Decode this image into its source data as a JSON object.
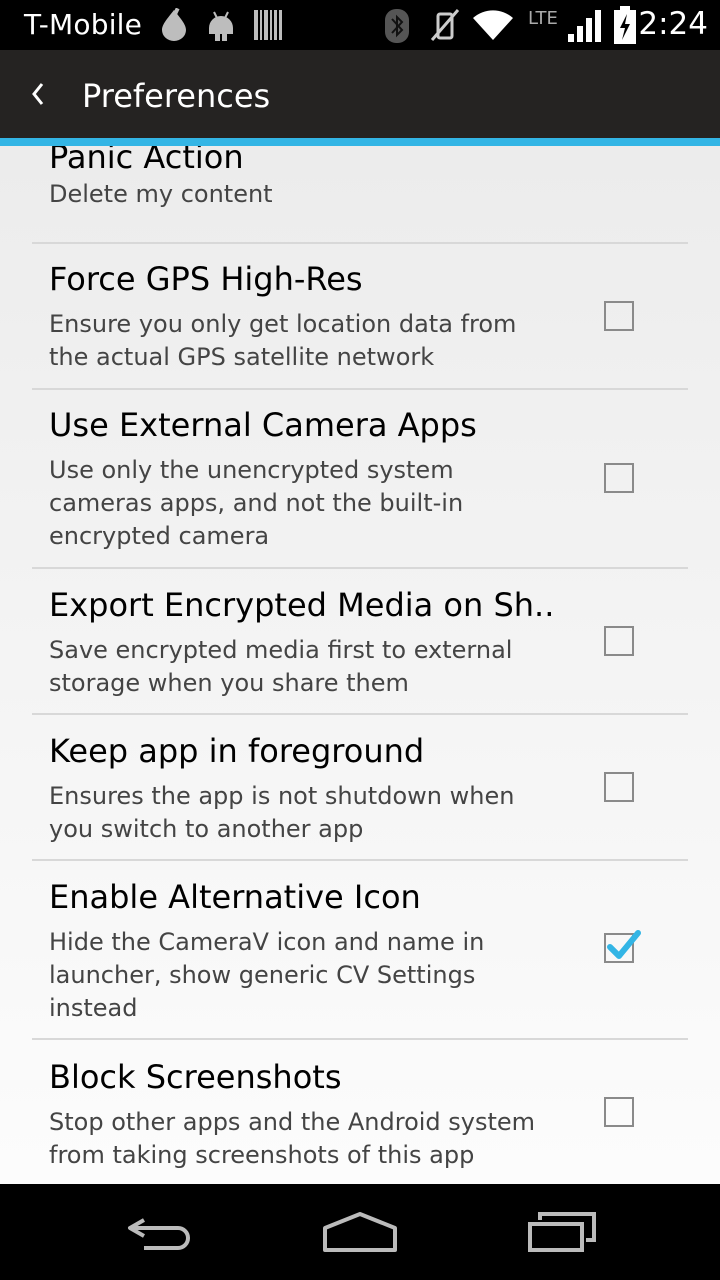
{
  "status_bar": {
    "carrier": "T-Mobile",
    "network_type": "LTE",
    "time": "2:24",
    "icons": [
      "cupcake-notification-icon",
      "android-notification-icon",
      "barcode-notification-icon",
      "bluetooth-icon",
      "vibrate-icon",
      "wifi-icon",
      "signal-icon",
      "battery-charging-icon"
    ]
  },
  "action_bar": {
    "title": "Preferences",
    "back_icon": "chevron-left-icon"
  },
  "accent_color": "#33b5e5",
  "preferences": [
    {
      "title": "Panic Action",
      "summary": "Delete my content"
    },
    {
      "title": "Force GPS High-Res",
      "summary": "Ensure you only get location data from the actual GPS satellite network",
      "checked": false
    },
    {
      "title": "Use External Camera Apps",
      "summary": "Use only the unencrypted system cameras apps, and not the built-in encrypted camera",
      "checked": false
    },
    {
      "title": "Export Encrypted Media on Sh..",
      "summary": "Save encrypted media first to external storage when you share them",
      "checked": false
    },
    {
      "title": "Keep app in foreground",
      "summary": "Ensures the app is not shutdown when you switch to another app",
      "checked": false
    },
    {
      "title": "Enable Alternative Icon",
      "summary": "Hide the CameraV icon and name in launcher, show generic CV Settings instead",
      "checked": true
    },
    {
      "title": "Block Screenshots",
      "summary": "Stop other apps and the Android system from taking screenshots of this app",
      "checked": false
    }
  ],
  "nav_bar": {
    "buttons": [
      "back-icon",
      "home-icon",
      "recent-apps-icon"
    ]
  }
}
